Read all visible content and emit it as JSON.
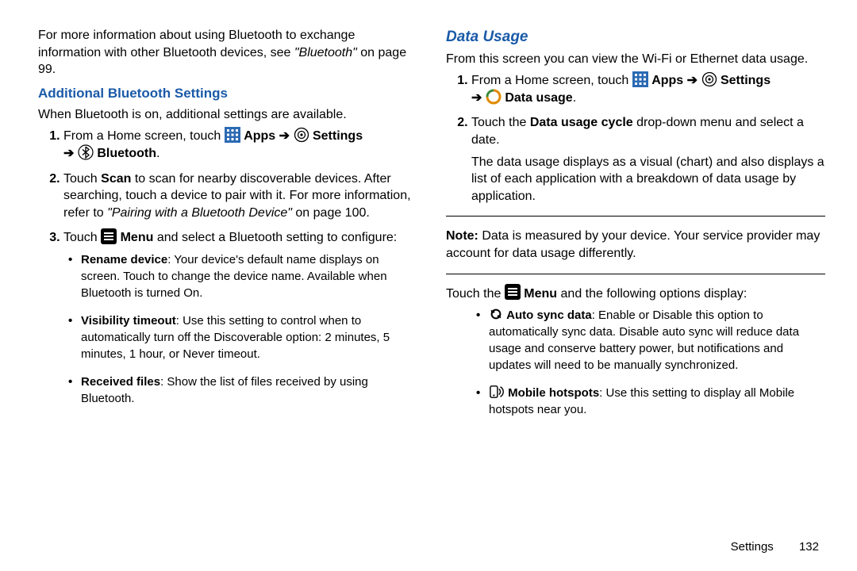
{
  "left": {
    "intro_a": "For more information about using Bluetooth to exchange information with other Bluetooth devices, see ",
    "intro_ref": "\"Bluetooth\"",
    "intro_b": " on page 99.",
    "h_add": "Additional Bluetooth Settings",
    "when_on": "When Bluetooth is on, additional settings are available.",
    "step1_a": "From a Home screen, touch ",
    "step1_apps": "Apps",
    "step1_settings": "Settings",
    "step1_bt": "Bluetooth",
    "period": ".",
    "step2_a": "Touch ",
    "step2_scan": "Scan",
    "step2_b": " to scan for nearby discoverable devices. After searching, touch a device to pair with it. For more information, refer to ",
    "step2_ref": "\"Pairing with a Bluetooth Device\"",
    "step2_c": " on page 100.",
    "step3_a": "Touch ",
    "step3_menu": "Menu",
    "step3_b": " and select a Bluetooth setting to configure:",
    "b1_h": "Rename device",
    "b1_t": ": Your device's default name displays on screen. Touch to change the device name. Available when Bluetooth is turned On.",
    "b2_h": "Visibility timeout",
    "b2_t": ": Use this setting to control when to automatically turn off the Discoverable option: 2 minutes, 5 minutes, 1 hour, or Never timeout.",
    "b3_h": "Received files",
    "b3_t": ": Show the list of files received by using Bluetooth."
  },
  "right": {
    "h_du": "Data Usage",
    "intro": "From this screen you can view the Wi-Fi or Ethernet data usage.",
    "step1_a": "From a Home screen, touch ",
    "step1_apps": "Apps",
    "step1_settings": "Settings",
    "step1_du": "Data usage",
    "period": ".",
    "step2_a": "Touch the ",
    "step2_b": "Data usage cycle",
    "step2_c": " drop-down menu and select a date.",
    "step2_p2": "The data usage displays as a visual (chart) and also displays a list of each application with a breakdown of data usage by application.",
    "note_h": "Note:",
    "note_t": " Data is measured by your device. Your service provider may account for data usage differently.",
    "touch_a": "Touch the ",
    "touch_menu": "Menu",
    "touch_b": " and the following options display:",
    "b1_h": "Auto sync data",
    "b1_t": ": Enable or Disable this option to automatically sync data. Disable auto sync will reduce data usage and conserve battery power, but notifications and updates will need to be manually synchronized.",
    "b2_h": "Mobile hotspots",
    "b2_t": ": Use this setting to display all Mobile hotspots near you."
  },
  "footer": {
    "section": "Settings",
    "page": "132"
  }
}
